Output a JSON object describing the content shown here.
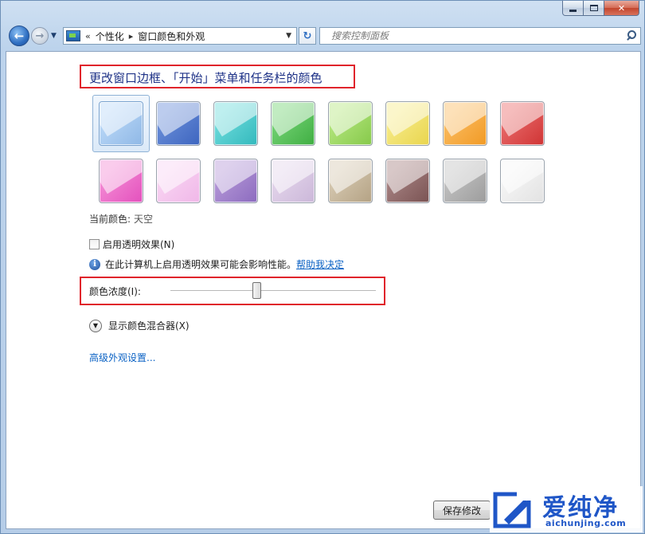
{
  "window": {
    "minimize_label": "",
    "maximize_label": "",
    "close_label": "✕"
  },
  "nav": {
    "back_icon": "←",
    "forward_icon": "→",
    "history_dropdown": "▼",
    "overflow_marker": "«",
    "breadcrumb_separator": "▸",
    "breadcrumbs": [
      "个性化",
      "窗口颜色和外观"
    ],
    "address_dropdown": "▼",
    "refresh_icon": "↻",
    "search_placeholder": "搜索控制面板"
  },
  "main": {
    "title": "更改窗口边框、「开始」菜单和任务栏的颜色",
    "swatches": [
      {
        "name": "天空",
        "color": "#bcd9f8",
        "dark": "#8fb8e6",
        "selected": true
      },
      {
        "name": "",
        "color": "#6b8fd9",
        "dark": "#3d65bf",
        "selected": false
      },
      {
        "name": "",
        "color": "#6fdcdc",
        "dark": "#33b9bd",
        "selected": false
      },
      {
        "name": "",
        "color": "#77d477",
        "dark": "#3fae42",
        "selected": false
      },
      {
        "name": "",
        "color": "#b6e780",
        "dark": "#86c94a",
        "selected": false
      },
      {
        "name": "",
        "color": "#f7ec8c",
        "dark": "#e9d54d",
        "selected": false
      },
      {
        "name": "",
        "color": "#fbbd64",
        "dark": "#f19a24",
        "selected": false
      },
      {
        "name": "",
        "color": "#ea6d6d",
        "dark": "#cf3434",
        "selected": false
      },
      {
        "name": "",
        "color": "#f48fd6",
        "dark": "#e450bd",
        "selected": false
      },
      {
        "name": "",
        "color": "#f9d6f3",
        "dark": "#f0b7e8",
        "selected": false
      },
      {
        "name": "",
        "color": "#b69ad8",
        "dark": "#8c6bbf",
        "selected": false
      },
      {
        "name": "",
        "color": "#e5d7ec",
        "dark": "#cbb7d9",
        "selected": false
      },
      {
        "name": "",
        "color": "#d8cbb4",
        "dark": "#b4a284",
        "selected": false
      },
      {
        "name": "",
        "color": "#a98585",
        "dark": "#7a5353",
        "selected": false
      },
      {
        "name": "",
        "color": "#c4c4c4",
        "dark": "#9c9c9c",
        "selected": false
      },
      {
        "name": "",
        "color": "#f7f7f7",
        "dark": "#e2e2e2",
        "selected": false
      }
    ],
    "current_color_label": "当前颜色:",
    "current_color_value": "天空",
    "transparency_label": "启用透明效果(N)",
    "transparency_checked": false,
    "info_text": "在此计算机上启用透明效果可能会影响性能。",
    "info_link": "帮助我决定",
    "intensity_label": "颜色浓度(I):",
    "intensity_level": 0.42,
    "mixer_label": "显示颜色混合器(X)",
    "advanced_link": "高级外观设置...",
    "save_button": "保存修改"
  },
  "watermark": {
    "text": "爱纯净",
    "url": "aichunjing.com"
  }
}
